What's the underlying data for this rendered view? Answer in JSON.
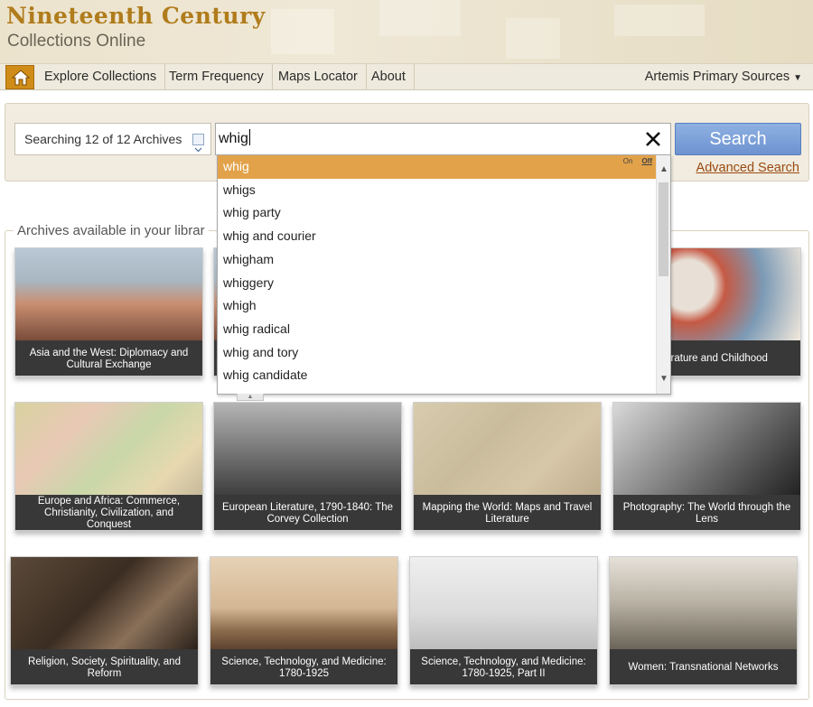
{
  "header": {
    "title_line1": "Nineteenth Century",
    "title_line2": "Collections Online"
  },
  "nav": {
    "home_icon": "home-icon",
    "items": [
      "Explore Collections",
      "Term Frequency",
      "Maps Locator",
      "About"
    ],
    "right_menu": "Artemis Primary Sources"
  },
  "search": {
    "archives_select": "Searching 12 of 12 Archives",
    "query": "whig",
    "button": "Search",
    "advanced_link": "Advanced Search"
  },
  "autocomplete": {
    "toggle_on": "On",
    "toggle_off": "Off",
    "suggestions": [
      "whig",
      "whigs",
      "whig party",
      "whig and courier",
      "whigham",
      "whiggery",
      "whigh",
      "whig radical",
      "whig and tory",
      "whig candidate"
    ]
  },
  "archives": {
    "legend": "Archives available in your librar",
    "cards": [
      "Asia and the West: Diplomacy and Cultural Exchange",
      "s Literature and Childhood",
      "Europe and Africa: Commerce, Christianity, Civilization, and Conquest",
      "European Literature, 1790-1840: The Corvey Collection",
      "Mapping the World: Maps and Travel Literature",
      "Photography: The World through the Lens",
      "Religion, Society, Spirituality, and Reform",
      "Science, Technology, and Medicine: 1780-1925",
      "Science, Technology, and Medicine: 1780-1925, Part II",
      "Women: Transnational Networks"
    ]
  },
  "colors": {
    "accent": "#cf8c18",
    "highlight": "#e2a24a",
    "search_button": "#7a9fd9",
    "link": "#9a4a12"
  }
}
